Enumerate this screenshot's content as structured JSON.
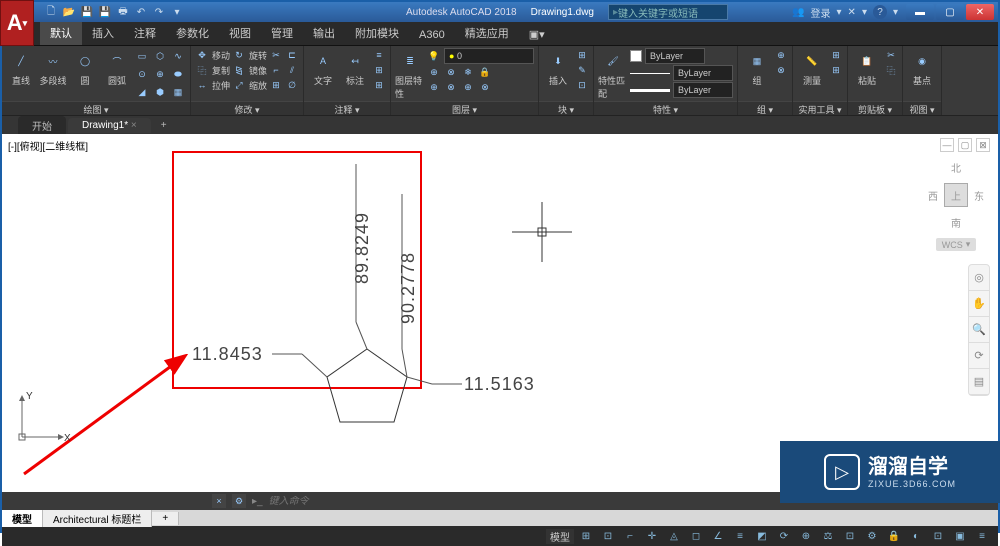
{
  "titlebar": {
    "app_name": "Autodesk AutoCAD 2018",
    "file_name": "Drawing1.dwg",
    "search_placeholder": "键入关键字或短语",
    "login_label": "登录",
    "logo_letter": "A"
  },
  "qat": [
    "new",
    "open",
    "save",
    "undo",
    "redo",
    "plot"
  ],
  "ribbon_tabs": [
    "默认",
    "插入",
    "注释",
    "参数化",
    "视图",
    "管理",
    "输出",
    "附加模块",
    "A360",
    "精选应用"
  ],
  "ribbon_active_tab": 0,
  "panels": {
    "draw": {
      "name": "绘图 ▾",
      "line": "直线",
      "polyline": "多段线",
      "circle": "圆",
      "arc": "圆弧"
    },
    "modify": {
      "name": "修改 ▾",
      "move": "移动",
      "copy": "复制",
      "stretch": "拉伸",
      "rotate": "旋转",
      "mirror": "镜像",
      "scale": "缩放"
    },
    "annotate": {
      "name": "注释 ▾",
      "text": "文字",
      "dim": "标注"
    },
    "layers": {
      "name": "图层 ▾",
      "props": "图层特性",
      "current": "0"
    },
    "block": {
      "name": "块 ▾",
      "insert": "插入"
    },
    "props": {
      "name": "特性 ▾",
      "btn": "特性匹配",
      "layer": "ByLayer"
    },
    "group": {
      "name": "组 ▾",
      "btn": "组"
    },
    "utils": {
      "name": "实用工具 ▾",
      "btn": "测量"
    },
    "clip": {
      "name": "剪贴板 ▾",
      "btn": "粘贴"
    },
    "view": {
      "name": "视图 ▾",
      "btn": "基点"
    }
  },
  "doc_tabs": {
    "start": "开始",
    "active": "Drawing1*",
    "add": "+"
  },
  "view_label": "[-][俯视][二维线框]",
  "viewcube": {
    "top": "北",
    "left": "西",
    "right": "东",
    "face": "上",
    "bottom": "南",
    "wcs": "WCS"
  },
  "dimensions": {
    "d1": "89.8249",
    "d2": "90.2778",
    "d3": "11.8453",
    "d4": "11.5163"
  },
  "ucs": {
    "x": "X",
    "y": "Y"
  },
  "command_line": {
    "placeholder": "键入命令"
  },
  "layout_tabs": {
    "model": "模型",
    "layout1": "Architectural 标题栏",
    "add": "+"
  },
  "statusbar": {
    "model": "模型"
  },
  "watermark": {
    "title": "溜溜自学",
    "url": "ZIXUE.3D66.COM"
  }
}
